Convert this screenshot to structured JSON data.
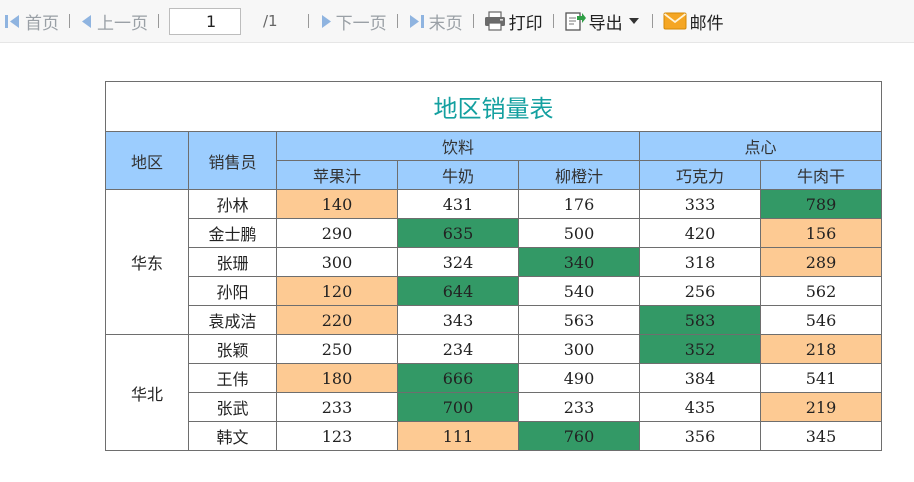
{
  "toolbar": {
    "first": "首页",
    "prev": "上一页",
    "page_value": "1",
    "page_total": "/1",
    "next": "下一页",
    "last": "末页",
    "print": "打印",
    "export": "导出",
    "mail": "邮件"
  },
  "report": {
    "title": "地区销量表",
    "col_region": "地区",
    "col_sales": "销售员",
    "group_drinks": "饮料",
    "group_snacks": "点心",
    "products": [
      "苹果汁",
      "牛奶",
      "柳橙汁",
      "巧克力",
      "牛肉干"
    ],
    "regions": [
      {
        "name": "华东",
        "rows": [
          {
            "name": "孙林",
            "values": [
              "140",
              "431",
              "176",
              "333",
              "789"
            ]
          },
          {
            "name": "金士鹏",
            "values": [
              "290",
              "635",
              "500",
              "420",
              "156"
            ]
          },
          {
            "name": "张珊",
            "values": [
              "300",
              "324",
              "340",
              "318",
              "289"
            ]
          },
          {
            "name": "孙阳",
            "values": [
              "120",
              "644",
              "540",
              "256",
              "562"
            ]
          },
          {
            "name": "袁成洁",
            "values": [
              "220",
              "343",
              "563",
              "583",
              "546"
            ]
          }
        ]
      },
      {
        "name": "华北",
        "rows": [
          {
            "name": "张颖",
            "values": [
              "250",
              "234",
              "300",
              "352",
              "218"
            ]
          },
          {
            "name": "王伟",
            "values": [
              "180",
              "666",
              "490",
              "384",
              "541"
            ]
          },
          {
            "name": "张武",
            "values": [
              "233",
              "700",
              "233",
              "435",
              "219"
            ]
          },
          {
            "name": "韩文",
            "values": [
              "123",
              "111",
              "760",
              "356",
              "345"
            ]
          }
        ]
      }
    ],
    "highlights": [
      [
        "o",
        "w",
        "w",
        "w",
        "g"
      ],
      [
        "w",
        "g",
        "w",
        "w",
        "o"
      ],
      [
        "w",
        "w",
        "g",
        "w",
        "o"
      ],
      [
        "o",
        "g",
        "w",
        "w",
        "w"
      ],
      [
        "o",
        "w",
        "w",
        "g",
        "w"
      ],
      [
        "w",
        "w",
        "w",
        "g",
        "o"
      ],
      [
        "o",
        "g",
        "w",
        "w",
        "w"
      ],
      [
        "w",
        "g",
        "w",
        "w",
        "o"
      ],
      [
        "w",
        "o",
        "g",
        "w",
        "w"
      ]
    ],
    "colors": {
      "low": "#fdca93",
      "high": "#339966",
      "header": "#9ccdfe",
      "title": "#14a0a0"
    }
  }
}
